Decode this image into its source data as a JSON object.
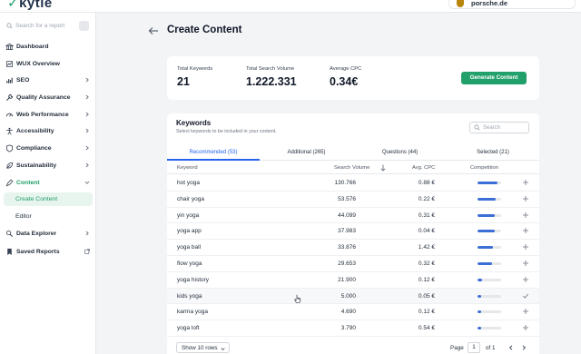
{
  "app": {
    "logo": "kytle"
  },
  "account": {
    "name": "porsche.de"
  },
  "sidebar": {
    "search_placeholder": "Search for a report",
    "items": [
      {
        "label": "Dashboard",
        "icon": "bank-icon",
        "chevron": false
      },
      {
        "label": "WUX Overview",
        "icon": "chart-icon",
        "chevron": false
      },
      {
        "label": "SEO",
        "icon": "bar-chart-icon",
        "chevron": true
      },
      {
        "label": "Quality Assurance",
        "icon": "wrench-icon",
        "chevron": true
      },
      {
        "label": "Web Performance",
        "icon": "gauge-icon",
        "chevron": true
      },
      {
        "label": "Accessibility",
        "icon": "person-icon",
        "chevron": true
      },
      {
        "label": "Compliance",
        "icon": "shield-icon",
        "chevron": true
      },
      {
        "label": "Sustainability",
        "icon": "leaf-icon",
        "chevron": true
      },
      {
        "label": "Content",
        "icon": "pen-icon",
        "chevron": true,
        "expanded": true
      },
      {
        "label": "Create Content",
        "sub": true,
        "active": true
      },
      {
        "label": "Editor",
        "sub": true
      },
      {
        "label": "Data Explorer",
        "icon": "explorer-icon",
        "chevron": true
      },
      {
        "label": "Saved Reports",
        "icon": "bookmark-icon",
        "chevron": false,
        "extra": "export-icon"
      }
    ]
  },
  "main": {
    "title": "Create Content",
    "stats": {
      "total_keywords_label": "Total Keywords",
      "total_keywords": "21",
      "volume_label": "Total Search Volume",
      "volume": "1.222.331",
      "cpc_label": "Average CPC",
      "cpc": "0.34€",
      "generate_label": "Generate Content"
    },
    "keywords": {
      "title": "Keywords",
      "subtitle": "Select keywords to be included in your content.",
      "search_placeholder": "Search",
      "tabs": [
        "Recommended (53)",
        "Additional (265)",
        "Questions (44)",
        "Selected (21)"
      ],
      "columns": {
        "keyword": "Keyword",
        "volume": "Search Volume",
        "cpc": "Avg. CPC",
        "competition": "Competition"
      },
      "rows": [
        {
          "keyword": "hot yoga",
          "volume": "130.766",
          "cpc": "0.88 €",
          "competition": 0.85,
          "selected": false
        },
        {
          "keyword": "chair yoga",
          "volume": "53.576",
          "cpc": "0.22 €",
          "competition": 0.78,
          "selected": false
        },
        {
          "keyword": "yin yoga",
          "volume": "44.099",
          "cpc": "0.31 €",
          "competition": 0.72,
          "selected": false
        },
        {
          "keyword": "yoga app",
          "volume": "37.983",
          "cpc": "0.04 €",
          "competition": 0.72,
          "selected": false
        },
        {
          "keyword": "yoga ball",
          "volume": "33.876",
          "cpc": "1.42 €",
          "competition": 0.66,
          "selected": false
        },
        {
          "keyword": "flow yoga",
          "volume": "29.653",
          "cpc": "0.32 €",
          "competition": 0.6,
          "selected": false
        },
        {
          "keyword": "yoga history",
          "volume": "21.900",
          "cpc": "0.12 €",
          "competition": 0.2,
          "selected": false
        },
        {
          "keyword": "kids yoga",
          "volume": "5.000",
          "cpc": "0.05 €",
          "competition": 0.15,
          "selected": true
        },
        {
          "keyword": "karma yoga",
          "volume": "4.690",
          "cpc": "0.12 €",
          "competition": 0.15,
          "selected": false
        },
        {
          "keyword": "yoga loft",
          "volume": "3.790",
          "cpc": "0.54 €",
          "competition": 0.15,
          "selected": false
        }
      ]
    },
    "footer": {
      "rows_select": "Show 10 rows",
      "page_label": "Page",
      "page_value": "1",
      "of_label": "of 1"
    }
  },
  "colors": {
    "accent": "#22a06b",
    "link": "#2563eb",
    "bar": "#3b6fd6"
  }
}
